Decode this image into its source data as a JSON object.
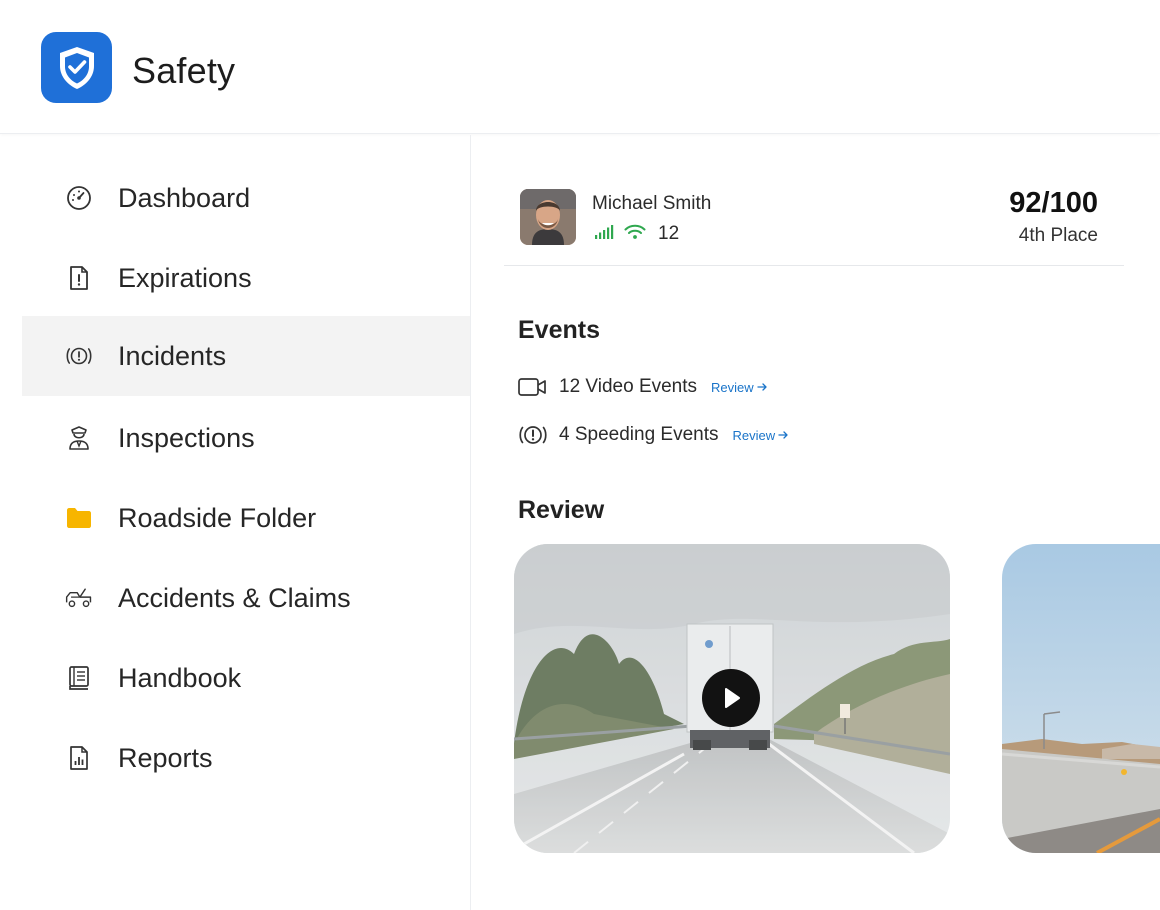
{
  "app": {
    "title": "Safety"
  },
  "sidebar": {
    "items": [
      {
        "label": "Dashboard",
        "icon": "gauge-icon",
        "active": false
      },
      {
        "label": "Expirations",
        "icon": "document-alert-icon",
        "active": false
      },
      {
        "label": "Incidents",
        "icon": "incident-alert-icon",
        "active": true
      },
      {
        "label": "Inspections",
        "icon": "officer-icon",
        "active": false
      },
      {
        "label": "Roadside Folder",
        "icon": "folder-icon",
        "active": false
      },
      {
        "label": "Accidents & Claims",
        "icon": "tow-truck-icon",
        "active": false
      },
      {
        "label": "Handbook",
        "icon": "book-icon",
        "active": false
      },
      {
        "label": "Reports",
        "icon": "report-icon",
        "active": false
      }
    ]
  },
  "driver": {
    "name": "Michael Smith",
    "signal_count": "12",
    "score": "92/100",
    "rank": "4th Place"
  },
  "events": {
    "title": "Events",
    "items": [
      {
        "label": "12 Video Events",
        "link": "Review",
        "icon": "video-camera-icon"
      },
      {
        "label": "4 Speeding Events",
        "link": "Review",
        "icon": "speeding-alert-icon"
      }
    ]
  },
  "review": {
    "title": "Review"
  },
  "colors": {
    "brand": "#1f70d8",
    "link": "#1a74c9",
    "signal_green": "#2fa84f",
    "folder_yellow": "#f7b500",
    "active_bg": "#f3f3f3"
  }
}
